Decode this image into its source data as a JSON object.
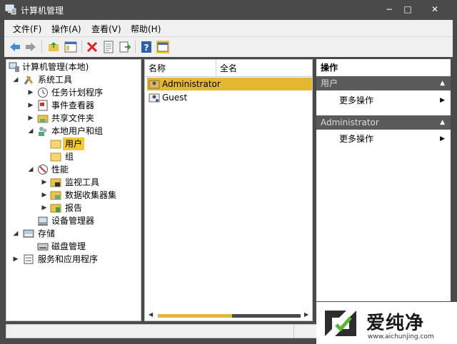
{
  "window": {
    "title": "计算机管理",
    "minimize": "−",
    "maximize": "□",
    "close": "✕"
  },
  "menu": [
    "文件(F)",
    "操作(A)",
    "查看(V)",
    "帮助(H)"
  ],
  "toolbar": {
    "icons": [
      "back-arrow-icon",
      "forward-arrow-icon",
      "up-folder-icon",
      "show-hide-tree-icon",
      "delete-icon",
      "properties-icon",
      "export-list-icon",
      "help-icon",
      "show-hide-action-pane-icon"
    ]
  },
  "tree": {
    "root": "计算机管理(本地)",
    "system_tools": "系统工具",
    "task_scheduler": "任务计划程序",
    "event_viewer": "事件查看器",
    "shared_folders": "共享文件夹",
    "local_users_groups": "本地用户和组",
    "users": "用户",
    "groups": "组",
    "performance": "性能",
    "monitoring_tools": "监视工具",
    "data_collector_sets": "数据收集器集",
    "reports": "报告",
    "device_manager": "设备管理器",
    "storage": "存储",
    "disk_management": "磁盘管理",
    "services_apps": "服务和应用程序"
  },
  "list": {
    "columns": [
      "名称",
      "全名"
    ],
    "rows": [
      "Administrator",
      "Guest"
    ]
  },
  "actions": {
    "title": "操作",
    "section1": "用户",
    "section1_item": "更多操作",
    "section2": "Administrator",
    "section2_item": "更多操作"
  },
  "watermark": {
    "brand": "爱纯净",
    "url": "www.aichunjing.com"
  },
  "colors": {
    "selection": "#e3b730",
    "titlebar": "#4a4a4a",
    "section_header": "#5a5a5a"
  }
}
